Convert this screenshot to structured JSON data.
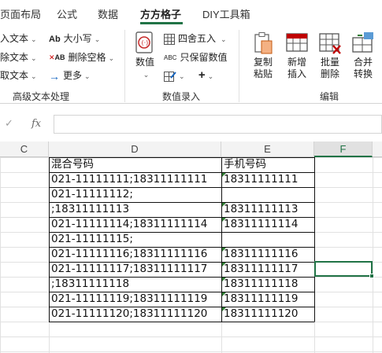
{
  "tabs": [
    "页面布局",
    "公式",
    "数据",
    "方方格子",
    "DIY工具箱"
  ],
  "active_tab": "方方格子",
  "ribbon": {
    "text_group": {
      "items": [
        "入文本",
        "除文本",
        "取文本"
      ],
      "items2": [
        "大小写",
        "删除空格",
        "更多"
      ],
      "label": "高级文本处理"
    },
    "number_group": {
      "big_button": "数值",
      "items": [
        "四舍五入",
        "只保留数值"
      ],
      "label": "数值录入"
    },
    "edit_group": {
      "buttons": [
        "复制粘贴",
        "新增插入",
        "批量删除",
        "合并转换"
      ],
      "label": "编辑"
    }
  },
  "formula_bar": {
    "fx": "fx",
    "value": ""
  },
  "columns": [
    "C",
    "D",
    "E",
    "F"
  ],
  "rows": [
    {
      "d": "混合号码",
      "e": "手机号码"
    },
    {
      "d": "021-11111111;18311111111",
      "e": "18311111111"
    },
    {
      "d": "021-11111112;",
      "e": ""
    },
    {
      "d": ";18311111113",
      "e": "18311111113"
    },
    {
      "d": "021-11111114;18311111114",
      "e": "18311111114"
    },
    {
      "d": "021-11111115;",
      "e": ""
    },
    {
      "d": "021-11111116;18311111116",
      "e": "18311111116"
    },
    {
      "d": "021-11111117;18311111117",
      "e": "18311111117"
    },
    {
      "d": ";18311111118",
      "e": "18311111118"
    },
    {
      "d": "021-11111119;18311111119",
      "e": "18311111119"
    },
    {
      "d": "021-11111120;18311111120",
      "e": "18311111120"
    }
  ],
  "colors": {
    "accent": "#217346",
    "indicator": "#2e7d32"
  }
}
